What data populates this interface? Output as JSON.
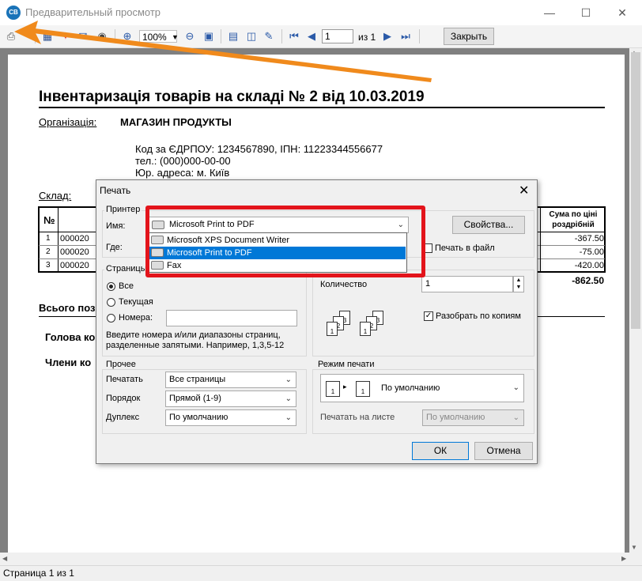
{
  "window": {
    "title": "Предварительный просмотр",
    "app_icon": "CB"
  },
  "toolbar": {
    "zoom": "100%",
    "page_value": "1",
    "page_of": "из 1",
    "close_label": "Закрыть"
  },
  "document": {
    "title": "Інвентаризація товарів на складі № 2 від 10.03.2019",
    "org_label": "Організація:",
    "org_value": "МАГАЗИН ПРОДУКТЫ",
    "code_line": "Код за ЄДРПОУ: 1234567890, ІПН: 11223344556677",
    "phone_line": "тел.: (000)000-00-00",
    "addr_line": "Юр. адреса: м. Київ",
    "sklad_label": "Склад:",
    "col_no": "№",
    "col_sum": "Сума по ціні роздрібній",
    "rows": [
      {
        "no": "1",
        "code": "000020",
        "sum": "-367.50"
      },
      {
        "no": "2",
        "code": "000020",
        "sum": "-75.00"
      },
      {
        "no": "3",
        "code": "000020",
        "sum": "-420.00"
      }
    ],
    "total": "-862.50",
    "total_label": "Всього поз",
    "head_label": "Голова ко",
    "members_label": "Члени ко"
  },
  "status": "Страница 1 из 1",
  "dialog": {
    "title": "Печать",
    "printer_legend": "Принтер",
    "name_label": "Имя:",
    "name_value": "Microsoft Print to PDF",
    "where_label": "Где:",
    "props_button": "Свойства...",
    "print_to_file": "Печать в файл",
    "printer_options": [
      "Microsoft XPS Document Writer",
      "Microsoft Print to PDF",
      "Fax"
    ],
    "pages_legend": "Страницы",
    "radio_all": "Все",
    "radio_current": "Текущая",
    "radio_numbers": "Номера:",
    "hint": "Введите номера и/или диапазоны страниц, разделенные запятыми. Например, 1,3,5-12",
    "copies_label": "Количество",
    "copies_value": "1",
    "collate_label": "Разобрать по копиям",
    "other_legend": "Прочее",
    "print_label": "Печатать",
    "print_value": "Все страницы",
    "order_label": "Порядок",
    "order_value": "Прямой (1-9)",
    "duplex_label": "Дуплекс",
    "duplex_value": "По умолчанию",
    "mode_legend": "Режим печати",
    "mode_value": "По умолчанию",
    "sheet_label": "Печатать на листе",
    "sheet_value": "По умолчанию",
    "ok": "ОК",
    "cancel": "Отмена"
  },
  "colors": {
    "accent_selection": "#0078d7",
    "annotation_red": "#e3141b",
    "annotation_orange": "#f08a1c"
  }
}
